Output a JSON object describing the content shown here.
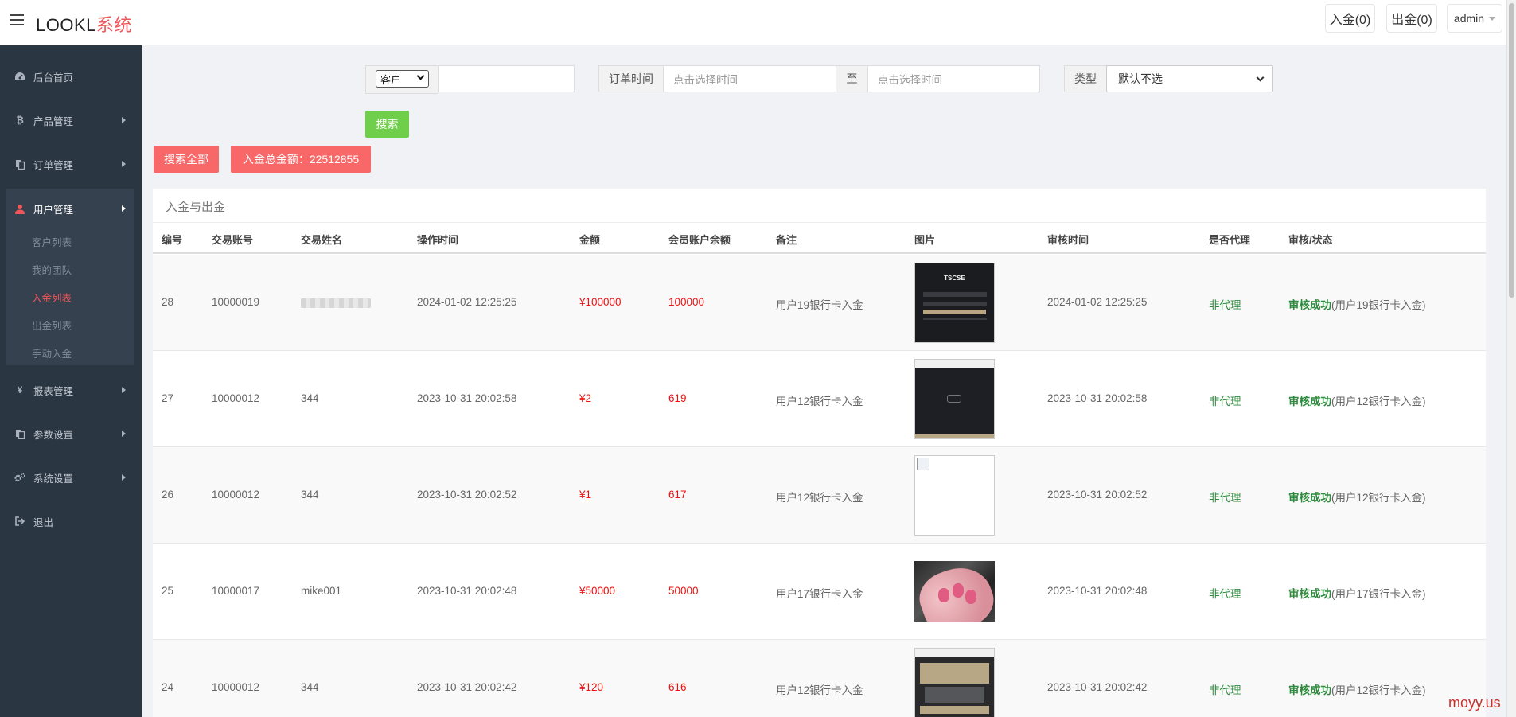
{
  "header": {
    "logo_main": "LOOKL",
    "logo_accent": "系统",
    "deposit_button": "入金(0)",
    "withdraw_button": "出金(0)",
    "admin_label": "admin"
  },
  "sidebar": {
    "items": [
      {
        "label": "后台首页",
        "icon": "dashboard-icon"
      },
      {
        "label": "产品管理",
        "icon": "bitcoin-icon"
      },
      {
        "label": "订单管理",
        "icon": "copy-icon"
      },
      {
        "label": "用户管理",
        "icon": "user-icon"
      },
      {
        "label": "报表管理",
        "icon": "yen-icon"
      },
      {
        "label": "参数设置",
        "icon": "copy-icon"
      },
      {
        "label": "系统设置",
        "icon": "gears-icon"
      },
      {
        "label": "退出",
        "icon": "signout-icon"
      }
    ],
    "sub_items": [
      "客户列表",
      "我的团队",
      "入金列表",
      "出金列表",
      "手动入金"
    ]
  },
  "filters": {
    "customer_select": "客户",
    "customer_input": "",
    "order_time_label": "订单时间",
    "time_start_placeholder": "点击选择时间",
    "to_label": "至",
    "time_end_placeholder": "点击选择时间",
    "type_label": "类型",
    "type_select": "默认不选",
    "search_button": "搜索",
    "search_all_button": "搜索全部",
    "total_label": "入金总金额：22512855"
  },
  "table": {
    "title": "入金与出金",
    "headers": [
      "编号",
      "交易账号",
      "交易姓名",
      "操作时间",
      "金额",
      "会员账户余额",
      "备注",
      "图片",
      "审核时间",
      "是否代理",
      "审核/状态"
    ],
    "rows": [
      {
        "id": "28",
        "account": "10000019",
        "name": "",
        "op_time": "2024-01-02 12:25:25",
        "amount": "¥100000",
        "balance": "100000",
        "note": "用户19银行卡入金",
        "review_time": "2024-01-02 12:25:25",
        "agent": "非代理",
        "status": "审核成功",
        "status_note": "(用户19银行卡入金)"
      },
      {
        "id": "27",
        "account": "10000012",
        "name": "344",
        "op_time": "2023-10-31 20:02:58",
        "amount": "¥2",
        "balance": "619",
        "note": "用户12银行卡入金",
        "review_time": "2023-10-31 20:02:58",
        "agent": "非代理",
        "status": "审核成功",
        "status_note": "(用户12银行卡入金)"
      },
      {
        "id": "26",
        "account": "10000012",
        "name": "344",
        "op_time": "2023-10-31 20:02:52",
        "amount": "¥1",
        "balance": "617",
        "note": "用户12银行卡入金",
        "review_time": "2023-10-31 20:02:52",
        "agent": "非代理",
        "status": "审核成功",
        "status_note": "(用户12银行卡入金)"
      },
      {
        "id": "25",
        "account": "10000017",
        "name": "mike001",
        "op_time": "2023-10-31 20:02:48",
        "amount": "¥50000",
        "balance": "50000",
        "note": "用户17银行卡入金",
        "review_time": "2023-10-31 20:02:48",
        "agent": "非代理",
        "status": "审核成功",
        "status_note": "(用户17银行卡入金)"
      },
      {
        "id": "24",
        "account": "10000012",
        "name": "344",
        "op_time": "2023-10-31 20:02:42",
        "amount": "¥120",
        "balance": "616",
        "note": "用户12银行卡入金",
        "review_time": "2023-10-31 20:02:42",
        "agent": "非代理",
        "status": "审核成功",
        "status_note": "(用户12银行卡入金)"
      }
    ]
  },
  "watermark": "moyy.us",
  "colors": {
    "accent": "#f0565a",
    "sidebar": "#2b3643",
    "success": "#2e8b3e",
    "money": "#ee1111",
    "search": "#6fcf4a"
  }
}
